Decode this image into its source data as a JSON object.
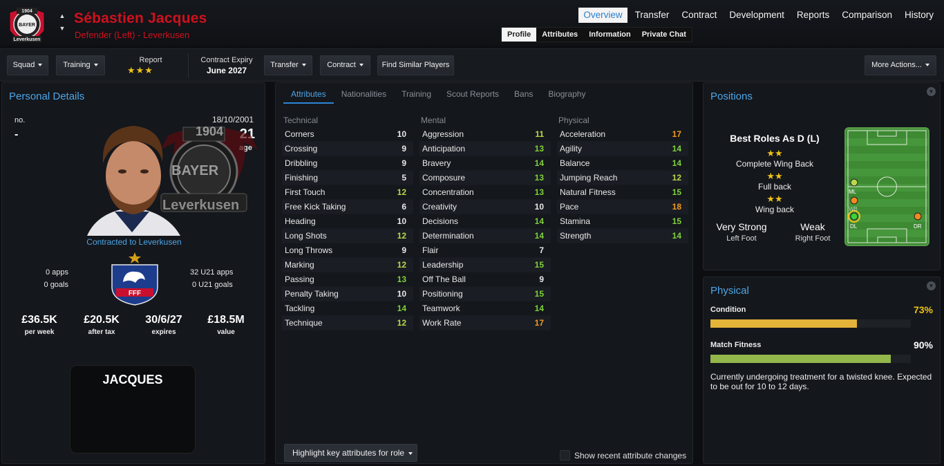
{
  "header": {
    "player_name": "Sébastien Jacques",
    "subtitle": "Defender (Left) - Leverkusen",
    "crest_text": [
      "1904",
      "BAYER",
      "Leverkusen"
    ]
  },
  "main_nav": [
    "Overview",
    "Transfer",
    "Contract",
    "Development",
    "Reports",
    "Comparison",
    "History"
  ],
  "sub_nav": [
    "Profile",
    "Attributes",
    "Information",
    "Private Chat"
  ],
  "toolbar": {
    "squad": "Squad",
    "training": "Training",
    "report_label": "Report",
    "report_stars": "★★★",
    "contract_expiry_label": "Contract Expiry",
    "contract_expiry_value": "June 2027",
    "transfer": "Transfer",
    "contract": "Contract",
    "find_similar": "Find Similar Players",
    "more_actions": "More Actions..."
  },
  "personal": {
    "title": "Personal Details",
    "no_label": "no.",
    "no_value": "-",
    "dob": "18/10/2001",
    "age": "21",
    "age_label": "age",
    "contracted": "Contracted to Leverkusen",
    "apps": "0 apps",
    "goals": "0 goals",
    "u21_apps": "32 U21 apps",
    "u21_goals": "0 U21 goals",
    "federation_text": "FFF",
    "finance": [
      {
        "value": "£36.5K",
        "label": "per week"
      },
      {
        "value": "£20.5K",
        "label": "after tax"
      },
      {
        "value": "30/6/27",
        "label": "expires"
      },
      {
        "value": "£18.5M",
        "label": "value"
      }
    ],
    "shirt_name": "JACQUES"
  },
  "attr_tabs": [
    "Attributes",
    "Nationalities",
    "Training",
    "Scout Reports",
    "Bans",
    "Biography"
  ],
  "attributes": {
    "technical": {
      "heading": "Technical",
      "rows": [
        {
          "name": "Corners",
          "value": "10"
        },
        {
          "name": "Crossing",
          "value": "9"
        },
        {
          "name": "Dribbling",
          "value": "9"
        },
        {
          "name": "Finishing",
          "value": "5"
        },
        {
          "name": "First Touch",
          "value": "12"
        },
        {
          "name": "Free Kick Taking",
          "value": "6"
        },
        {
          "name": "Heading",
          "value": "10"
        },
        {
          "name": "Long Shots",
          "value": "12"
        },
        {
          "name": "Long Throws",
          "value": "9"
        },
        {
          "name": "Marking",
          "value": "12"
        },
        {
          "name": "Passing",
          "value": "13"
        },
        {
          "name": "Penalty Taking",
          "value": "10"
        },
        {
          "name": "Tackling",
          "value": "14"
        },
        {
          "name": "Technique",
          "value": "12"
        }
      ]
    },
    "mental": {
      "heading": "Mental",
      "rows": [
        {
          "name": "Aggression",
          "value": "11"
        },
        {
          "name": "Anticipation",
          "value": "13"
        },
        {
          "name": "Bravery",
          "value": "14"
        },
        {
          "name": "Composure",
          "value": "13"
        },
        {
          "name": "Concentration",
          "value": "13"
        },
        {
          "name": "Creativity",
          "value": "10"
        },
        {
          "name": "Decisions",
          "value": "14"
        },
        {
          "name": "Determination",
          "value": "14"
        },
        {
          "name": "Flair",
          "value": "7"
        },
        {
          "name": "Leadership",
          "value": "15"
        },
        {
          "name": "Off The Ball",
          "value": "9"
        },
        {
          "name": "Positioning",
          "value": "15"
        },
        {
          "name": "Teamwork",
          "value": "14"
        },
        {
          "name": "Work Rate",
          "value": "17"
        }
      ]
    },
    "physical": {
      "heading": "Physical",
      "rows": [
        {
          "name": "Acceleration",
          "value": "17"
        },
        {
          "name": "Agility",
          "value": "14"
        },
        {
          "name": "Balance",
          "value": "14"
        },
        {
          "name": "Jumping Reach",
          "value": "12"
        },
        {
          "name": "Natural Fitness",
          "value": "15"
        },
        {
          "name": "Pace",
          "value": "18"
        },
        {
          "name": "Stamina",
          "value": "15"
        },
        {
          "name": "Strength",
          "value": "14"
        }
      ]
    }
  },
  "highlight_button": "Highlight key attributes for role",
  "show_recent": "Show recent attribute changes",
  "positions": {
    "title": "Positions",
    "best_roles": "Best Roles As D (L)",
    "roles": [
      {
        "stars": "★★",
        "name": "Complete Wing Back"
      },
      {
        "stars": "★★",
        "name": "Full back"
      },
      {
        "stars": "★★",
        "name": "Wing back"
      }
    ],
    "left_foot_value": "Very Strong",
    "left_foot_label": "Left Foot",
    "right_foot_value": "Weak",
    "right_foot_label": "Right Foot",
    "pitch_markers": [
      "ML",
      "WB",
      "DL",
      "DR"
    ]
  },
  "physical_panel": {
    "title": "Physical",
    "condition_label": "Condition",
    "condition_value": "73%",
    "condition_fraction": 0.73,
    "fitness_label": "Match Fitness",
    "fitness_value": "90%",
    "fitness_fraction": 0.9,
    "injury_note": "Currently undergoing treatment for a twisted knee. Expected to be out for 10 to 12 days."
  },
  "colors": {
    "name_red": "#d1101d",
    "accent_blue": "#4ea6e8",
    "value_orange": "#f29a1f",
    "value_green": "#7fd23a",
    "condition_bar": "#e3b33a",
    "fitness_bar": "#93b74a"
  }
}
